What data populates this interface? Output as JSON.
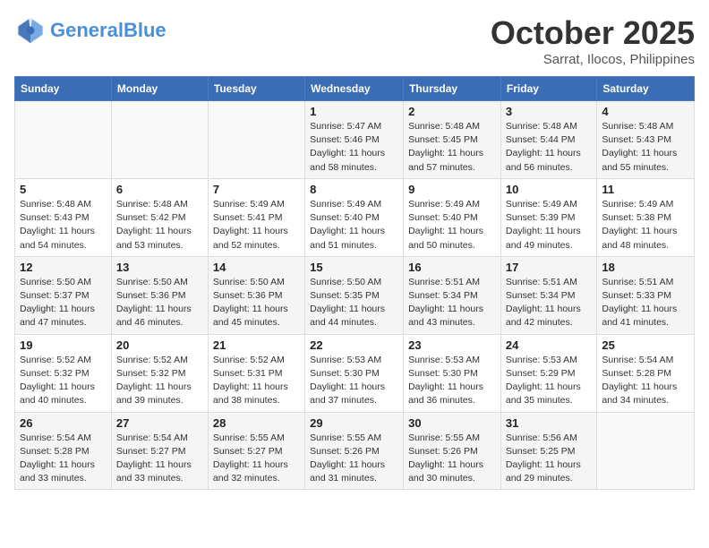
{
  "header": {
    "logo_line1": "General",
    "logo_line2": "Blue",
    "month": "October 2025",
    "location": "Sarrat, Ilocos, Philippines"
  },
  "weekdays": [
    "Sunday",
    "Monday",
    "Tuesday",
    "Wednesday",
    "Thursday",
    "Friday",
    "Saturday"
  ],
  "weeks": [
    [
      {
        "day": "",
        "text": ""
      },
      {
        "day": "",
        "text": ""
      },
      {
        "day": "",
        "text": ""
      },
      {
        "day": "1",
        "text": "Sunrise: 5:47 AM\nSunset: 5:46 PM\nDaylight: 11 hours and 58 minutes."
      },
      {
        "day": "2",
        "text": "Sunrise: 5:48 AM\nSunset: 5:45 PM\nDaylight: 11 hours and 57 minutes."
      },
      {
        "day": "3",
        "text": "Sunrise: 5:48 AM\nSunset: 5:44 PM\nDaylight: 11 hours and 56 minutes."
      },
      {
        "day": "4",
        "text": "Sunrise: 5:48 AM\nSunset: 5:43 PM\nDaylight: 11 hours and 55 minutes."
      }
    ],
    [
      {
        "day": "5",
        "text": "Sunrise: 5:48 AM\nSunset: 5:43 PM\nDaylight: 11 hours and 54 minutes."
      },
      {
        "day": "6",
        "text": "Sunrise: 5:48 AM\nSunset: 5:42 PM\nDaylight: 11 hours and 53 minutes."
      },
      {
        "day": "7",
        "text": "Sunrise: 5:49 AM\nSunset: 5:41 PM\nDaylight: 11 hours and 52 minutes."
      },
      {
        "day": "8",
        "text": "Sunrise: 5:49 AM\nSunset: 5:40 PM\nDaylight: 11 hours and 51 minutes."
      },
      {
        "day": "9",
        "text": "Sunrise: 5:49 AM\nSunset: 5:40 PM\nDaylight: 11 hours and 50 minutes."
      },
      {
        "day": "10",
        "text": "Sunrise: 5:49 AM\nSunset: 5:39 PM\nDaylight: 11 hours and 49 minutes."
      },
      {
        "day": "11",
        "text": "Sunrise: 5:49 AM\nSunset: 5:38 PM\nDaylight: 11 hours and 48 minutes."
      }
    ],
    [
      {
        "day": "12",
        "text": "Sunrise: 5:50 AM\nSunset: 5:37 PM\nDaylight: 11 hours and 47 minutes."
      },
      {
        "day": "13",
        "text": "Sunrise: 5:50 AM\nSunset: 5:36 PM\nDaylight: 11 hours and 46 minutes."
      },
      {
        "day": "14",
        "text": "Sunrise: 5:50 AM\nSunset: 5:36 PM\nDaylight: 11 hours and 45 minutes."
      },
      {
        "day": "15",
        "text": "Sunrise: 5:50 AM\nSunset: 5:35 PM\nDaylight: 11 hours and 44 minutes."
      },
      {
        "day": "16",
        "text": "Sunrise: 5:51 AM\nSunset: 5:34 PM\nDaylight: 11 hours and 43 minutes."
      },
      {
        "day": "17",
        "text": "Sunrise: 5:51 AM\nSunset: 5:34 PM\nDaylight: 11 hours and 42 minutes."
      },
      {
        "day": "18",
        "text": "Sunrise: 5:51 AM\nSunset: 5:33 PM\nDaylight: 11 hours and 41 minutes."
      }
    ],
    [
      {
        "day": "19",
        "text": "Sunrise: 5:52 AM\nSunset: 5:32 PM\nDaylight: 11 hours and 40 minutes."
      },
      {
        "day": "20",
        "text": "Sunrise: 5:52 AM\nSunset: 5:32 PM\nDaylight: 11 hours and 39 minutes."
      },
      {
        "day": "21",
        "text": "Sunrise: 5:52 AM\nSunset: 5:31 PM\nDaylight: 11 hours and 38 minutes."
      },
      {
        "day": "22",
        "text": "Sunrise: 5:53 AM\nSunset: 5:30 PM\nDaylight: 11 hours and 37 minutes."
      },
      {
        "day": "23",
        "text": "Sunrise: 5:53 AM\nSunset: 5:30 PM\nDaylight: 11 hours and 36 minutes."
      },
      {
        "day": "24",
        "text": "Sunrise: 5:53 AM\nSunset: 5:29 PM\nDaylight: 11 hours and 35 minutes."
      },
      {
        "day": "25",
        "text": "Sunrise: 5:54 AM\nSunset: 5:28 PM\nDaylight: 11 hours and 34 minutes."
      }
    ],
    [
      {
        "day": "26",
        "text": "Sunrise: 5:54 AM\nSunset: 5:28 PM\nDaylight: 11 hours and 33 minutes."
      },
      {
        "day": "27",
        "text": "Sunrise: 5:54 AM\nSunset: 5:27 PM\nDaylight: 11 hours and 33 minutes."
      },
      {
        "day": "28",
        "text": "Sunrise: 5:55 AM\nSunset: 5:27 PM\nDaylight: 11 hours and 32 minutes."
      },
      {
        "day": "29",
        "text": "Sunrise: 5:55 AM\nSunset: 5:26 PM\nDaylight: 11 hours and 31 minutes."
      },
      {
        "day": "30",
        "text": "Sunrise: 5:55 AM\nSunset: 5:26 PM\nDaylight: 11 hours and 30 minutes."
      },
      {
        "day": "31",
        "text": "Sunrise: 5:56 AM\nSunset: 5:25 PM\nDaylight: 11 hours and 29 minutes."
      },
      {
        "day": "",
        "text": ""
      }
    ]
  ]
}
